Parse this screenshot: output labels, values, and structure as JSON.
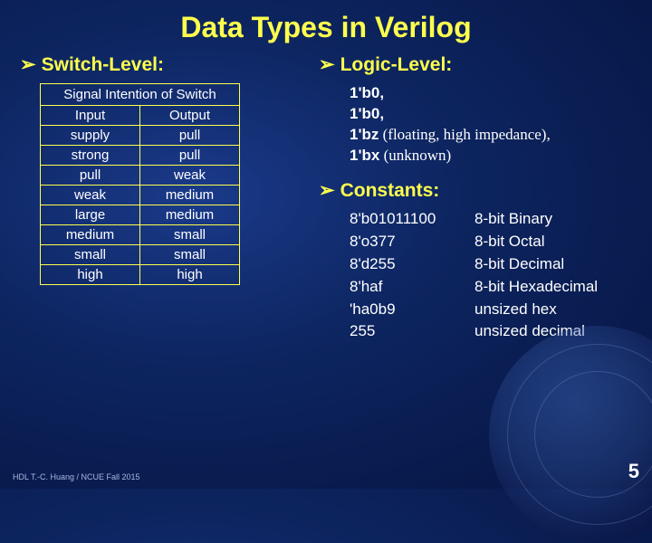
{
  "title": "Data Types in Verilog",
  "left": {
    "heading": "Switch-Level:",
    "table_caption": "Signal Intention of Switch",
    "headers": [
      "Input",
      "Output"
    ],
    "rows": [
      [
        "supply",
        "pull"
      ],
      [
        "strong",
        "pull"
      ],
      [
        "pull",
        "weak"
      ],
      [
        "weak",
        "medium"
      ],
      [
        "large",
        "medium"
      ],
      [
        "medium",
        "small"
      ],
      [
        "small",
        "small"
      ],
      [
        "high",
        "high"
      ]
    ]
  },
  "right": {
    "logic_heading": "Logic-Level:",
    "logic_items": [
      {
        "code": "1'b0,",
        "note": ""
      },
      {
        "code": "1'b0,",
        "note": ""
      },
      {
        "code": "1'bz",
        "note": " (floating, high impedance),"
      },
      {
        "code": "1'bx",
        "note": " (unknown)"
      }
    ],
    "const_heading": "Constants:",
    "constants": [
      {
        "lit": "8'b01011100",
        "desc": "8-bit Binary"
      },
      {
        "lit": "8'o377",
        "desc": "8-bit Octal"
      },
      {
        "lit": "8'd255",
        "desc": "8-bit Decimal"
      },
      {
        "lit": "8'haf",
        "desc": "8-bit Hexadecimal"
      },
      {
        "lit": "'ha0b9",
        "desc": "unsized hex"
      },
      {
        "lit": "255",
        "desc": "unsized decimal"
      }
    ]
  },
  "footer": "HDL    T.-C. Huang / NCUE  Fall 2015",
  "page": "5",
  "chart_data": {
    "type": "table",
    "title": "Signal Intention of Switch",
    "columns": [
      "Input",
      "Output"
    ],
    "rows": [
      [
        "supply",
        "pull"
      ],
      [
        "strong",
        "pull"
      ],
      [
        "pull",
        "weak"
      ],
      [
        "weak",
        "medium"
      ],
      [
        "large",
        "medium"
      ],
      [
        "medium",
        "small"
      ],
      [
        "small",
        "small"
      ],
      [
        "high",
        "high"
      ]
    ]
  }
}
